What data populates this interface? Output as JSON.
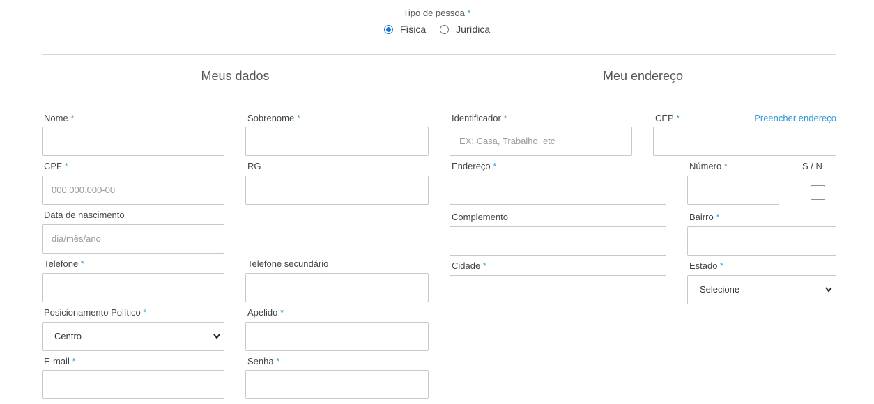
{
  "tipo": {
    "label": "Tipo de pessoa",
    "required": "*",
    "options": [
      {
        "label": "Física",
        "checked": true
      },
      {
        "label": "Jurídica",
        "checked": false
      }
    ]
  },
  "left": {
    "title": "Meus dados",
    "fields": {
      "nome": {
        "label": "Nome",
        "req": "*"
      },
      "sobrenome": {
        "label": "Sobrenome",
        "req": "*"
      },
      "cpf": {
        "label": "CPF",
        "req": "*",
        "placeholder": "000.000.000-00"
      },
      "rg": {
        "label": "RG"
      },
      "nascimento": {
        "label": "Data de nascimento",
        "placeholder": "dia/mês/ano"
      },
      "telefone": {
        "label": "Telefone",
        "req": "*"
      },
      "telefone2": {
        "label": "Telefone secundário"
      },
      "posicionamento": {
        "label": "Posicionamento Político",
        "req": "*",
        "value": "Centro"
      },
      "apelido": {
        "label": "Apelido",
        "req": "*"
      },
      "email": {
        "label": "E-mail",
        "req": "*"
      },
      "senha": {
        "label": "Senha",
        "req": "*"
      }
    }
  },
  "right": {
    "title": "Meu endereço",
    "fill_link": "Preencher endereço",
    "fields": {
      "identificador": {
        "label": "Identificador",
        "req": "*",
        "placeholder": "EX: Casa, Trabalho, etc"
      },
      "cep": {
        "label": "CEP",
        "req": "*"
      },
      "endereco": {
        "label": "Endereço",
        "req": "*"
      },
      "numero": {
        "label": "Número",
        "req": "*"
      },
      "sn": {
        "label": "S / N"
      },
      "complemento": {
        "label": "Complemento"
      },
      "bairro": {
        "label": "Bairro",
        "req": "*"
      },
      "cidade": {
        "label": "Cidade",
        "req": "*"
      },
      "estado": {
        "label": "Estado",
        "req": "*",
        "value": "Selecione"
      }
    }
  },
  "colors": {
    "accent": "#3aa0d6",
    "radio": "#1976d2",
    "border": "#c8c8c8"
  }
}
